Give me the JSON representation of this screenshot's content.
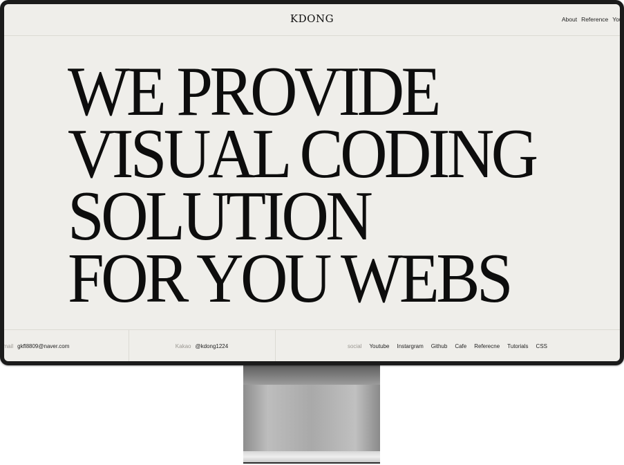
{
  "header": {
    "logo": "KDONG",
    "nav": [
      "About",
      "Reference",
      "Yout"
    ]
  },
  "hero": {
    "lines": [
      "WE PROVIDE",
      "VISUAL CODING",
      "SOLUTION",
      "FOR YOU WEBS"
    ]
  },
  "footer": {
    "email_label": "email",
    "email_value": "gkfl8809@naver.com",
    "kakao_label": "Kakao",
    "kakao_value": "@kdong1224",
    "social_label": "social",
    "social_links": [
      "Youtube",
      "Instargram",
      "Github",
      "Cafe",
      "Referecne",
      "Tutorials",
      "CSS"
    ]
  },
  "colors": {
    "screen_bg": "#efeeea",
    "bezel": "#1b1b1b",
    "text": "#0d0d0d",
    "muted": "#9a9791"
  }
}
